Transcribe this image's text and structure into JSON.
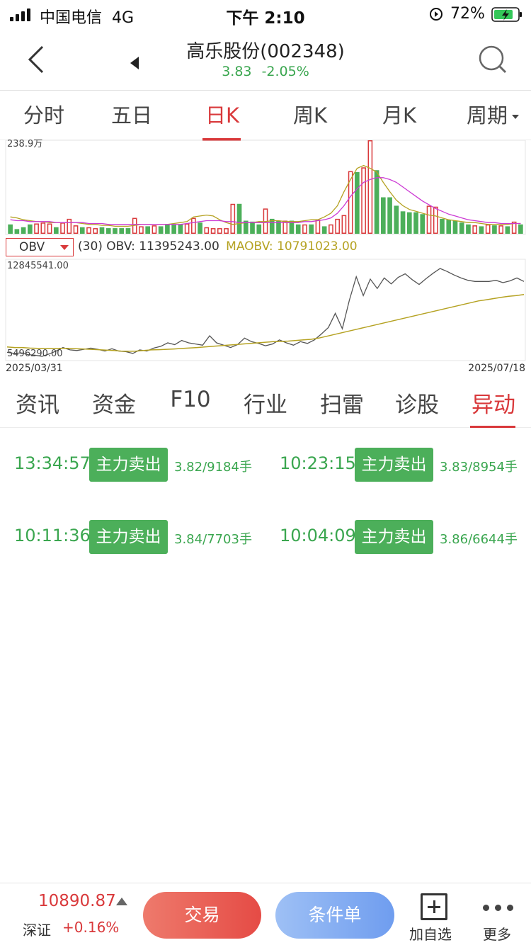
{
  "status_bar": {
    "carrier": "中国电信",
    "network": "4G",
    "time": "下午 2:10",
    "battery_percent": "72%"
  },
  "header": {
    "title": "高乐股份(002348)",
    "price": "3.83",
    "change_pct": "-2.05%"
  },
  "period_tabs": [
    {
      "label": "分时",
      "active": false
    },
    {
      "label": "五日",
      "active": false
    },
    {
      "label": "日K",
      "active": true
    },
    {
      "label": "周K",
      "active": false
    },
    {
      "label": "月K",
      "active": false
    },
    {
      "label": "周期",
      "active": false
    }
  ],
  "chart": {
    "volume_axis_label": "238.9万",
    "indicator_selected": "OBV",
    "obv_legend": "(30) OBV: 11395243.00",
    "maobv_legend": "MAOBV: 10791023.00",
    "obv_axis_max": "12845541.00",
    "obv_axis_min": "5496290.00",
    "date_start": "2025/03/31",
    "date_end": "2025/07/18"
  },
  "chart_data": {
    "type": "bar",
    "volume_max": 2389000,
    "volume_series": [
      {
        "up": false,
        "v": 0.1
      },
      {
        "up": false,
        "v": 0.05
      },
      {
        "up": false,
        "v": 0.07
      },
      {
        "up": false,
        "v": 0.1
      },
      {
        "up": true,
        "v": 0.11
      },
      {
        "up": true,
        "v": 0.12
      },
      {
        "up": true,
        "v": 0.11
      },
      {
        "up": false,
        "v": 0.07
      },
      {
        "up": true,
        "v": 0.12
      },
      {
        "up": true,
        "v": 0.16
      },
      {
        "up": true,
        "v": 0.09
      },
      {
        "up": false,
        "v": 0.07
      },
      {
        "up": true,
        "v": 0.07
      },
      {
        "up": true,
        "v": 0.06
      },
      {
        "up": false,
        "v": 0.07
      },
      {
        "up": false,
        "v": 0.06
      },
      {
        "up": false,
        "v": 0.06
      },
      {
        "up": false,
        "v": 0.06
      },
      {
        "up": false,
        "v": 0.06
      },
      {
        "up": true,
        "v": 0.17
      },
      {
        "up": true,
        "v": 0.08
      },
      {
        "up": false,
        "v": 0.08
      },
      {
        "up": true,
        "v": 0.09
      },
      {
        "up": false,
        "v": 0.08
      },
      {
        "up": false,
        "v": 0.1
      },
      {
        "up": false,
        "v": 0.1
      },
      {
        "up": false,
        "v": 0.1
      },
      {
        "up": true,
        "v": 0.11
      },
      {
        "up": true,
        "v": 0.17
      },
      {
        "up": false,
        "v": 0.12
      },
      {
        "up": true,
        "v": 0.07
      },
      {
        "up": true,
        "v": 0.06
      },
      {
        "up": true,
        "v": 0.06
      },
      {
        "up": true,
        "v": 0.06
      },
      {
        "up": true,
        "v": 0.32
      },
      {
        "up": false,
        "v": 0.32
      },
      {
        "up": false,
        "v": 0.14
      },
      {
        "up": false,
        "v": 0.13
      },
      {
        "up": false,
        "v": 0.1
      },
      {
        "up": true,
        "v": 0.27
      },
      {
        "up": false,
        "v": 0.16
      },
      {
        "up": false,
        "v": 0.14
      },
      {
        "up": true,
        "v": 0.14
      },
      {
        "up": false,
        "v": 0.14
      },
      {
        "up": false,
        "v": 0.1
      },
      {
        "up": true,
        "v": 0.1
      },
      {
        "up": false,
        "v": 0.1
      },
      {
        "up": true,
        "v": 0.15
      },
      {
        "up": false,
        "v": 0.08
      },
      {
        "up": true,
        "v": 0.1
      },
      {
        "up": true,
        "v": 0.16
      },
      {
        "up": true,
        "v": 0.2
      },
      {
        "up": true,
        "v": 0.67
      },
      {
        "up": false,
        "v": 0.66
      },
      {
        "up": true,
        "v": 0.71
      },
      {
        "up": true,
        "v": 1.0
      },
      {
        "up": false,
        "v": 0.68
      },
      {
        "up": false,
        "v": 0.39
      },
      {
        "up": false,
        "v": 0.39
      },
      {
        "up": false,
        "v": 0.3
      },
      {
        "up": false,
        "v": 0.24
      },
      {
        "up": false,
        "v": 0.23
      },
      {
        "up": false,
        "v": 0.23
      },
      {
        "up": false,
        "v": 0.21
      },
      {
        "up": true,
        "v": 0.3
      },
      {
        "up": true,
        "v": 0.29
      },
      {
        "up": false,
        "v": 0.16
      },
      {
        "up": false,
        "v": 0.15
      },
      {
        "up": false,
        "v": 0.14
      },
      {
        "up": false,
        "v": 0.12
      },
      {
        "up": false,
        "v": 0.1
      },
      {
        "up": true,
        "v": 0.09
      },
      {
        "up": false,
        "v": 0.08
      },
      {
        "up": true,
        "v": 0.1
      },
      {
        "up": false,
        "v": 0.09
      },
      {
        "up": true,
        "v": 0.09
      },
      {
        "up": false,
        "v": 0.08
      },
      {
        "up": true,
        "v": 0.13
      },
      {
        "up": false,
        "v": 0.1
      }
    ],
    "volume_ma_short": [
      0.18,
      0.17,
      0.15,
      0.14,
      0.13,
      0.13,
      0.12,
      0.12,
      0.12,
      0.12,
      0.12,
      0.11,
      0.1,
      0.1,
      0.09,
      0.09,
      0.08,
      0.08,
      0.08,
      0.09,
      0.1,
      0.1,
      0.1,
      0.1,
      0.1,
      0.11,
      0.12,
      0.13,
      0.18,
      0.19,
      0.2,
      0.19,
      0.15,
      0.12,
      0.1,
      0.11,
      0.12,
      0.12,
      0.13,
      0.13,
      0.14,
      0.14,
      0.13,
      0.13,
      0.13,
      0.14,
      0.15,
      0.15,
      0.18,
      0.22,
      0.3,
      0.45,
      0.58,
      0.7,
      0.73,
      0.7,
      0.66,
      0.55,
      0.45,
      0.36,
      0.3,
      0.26,
      0.24,
      0.22,
      0.2,
      0.19,
      0.17,
      0.15,
      0.14,
      0.13,
      0.12,
      0.12,
      0.11,
      0.1,
      0.1,
      0.1,
      0.1,
      0.11,
      0.11
    ],
    "volume_ma_long": [
      0.15,
      0.14,
      0.14,
      0.13,
      0.13,
      0.13,
      0.13,
      0.12,
      0.12,
      0.12,
      0.12,
      0.12,
      0.11,
      0.11,
      0.11,
      0.1,
      0.1,
      0.1,
      0.1,
      0.1,
      0.1,
      0.1,
      0.1,
      0.1,
      0.1,
      0.1,
      0.1,
      0.11,
      0.12,
      0.13,
      0.14,
      0.14,
      0.14,
      0.13,
      0.13,
      0.12,
      0.12,
      0.12,
      0.12,
      0.12,
      0.12,
      0.12,
      0.12,
      0.12,
      0.12,
      0.13,
      0.13,
      0.14,
      0.15,
      0.17,
      0.22,
      0.3,
      0.4,
      0.48,
      0.55,
      0.58,
      0.6,
      0.6,
      0.58,
      0.55,
      0.5,
      0.45,
      0.4,
      0.35,
      0.31,
      0.27,
      0.24,
      0.21,
      0.19,
      0.17,
      0.15,
      0.14,
      0.13,
      0.12,
      0.12,
      0.11,
      0.11,
      0.11,
      0.11
    ],
    "obv_series": [
      5900000,
      5800000,
      5850000,
      5700000,
      5650000,
      5550000,
      5750000,
      6000000,
      6300000,
      6100000,
      6050000,
      6150000,
      6250000,
      6150000,
      6000000,
      6200000,
      6000000,
      5950000,
      5800000,
      6100000,
      6000000,
      6250000,
      6400000,
      6700000,
      6550000,
      6900000,
      6700000,
      6600000,
      6500000,
      7300000,
      6700000,
      6500000,
      6300000,
      6550000,
      7100000,
      6800000,
      6650000,
      6450000,
      6600000,
      6950000,
      6700000,
      6500000,
      6800000,
      6650000,
      6950000,
      7450000,
      8000000,
      9200000,
      7900000,
      10300000,
      12300000,
      10700000,
      12100000,
      11300000,
      12200000,
      11700000,
      12250000,
      12550000,
      12050000,
      11650000,
      12150000,
      12600000,
      13000000,
      12750000,
      12450000,
      12200000,
      12000000,
      11900000,
      11900000,
      11900000,
      12000000,
      11800000,
      11950000,
      12200000,
      11900000
    ],
    "maobv_series": [
      6350000,
      6300000,
      6300000,
      6250000,
      6230000,
      6230000,
      6230000,
      6230000,
      6230000,
      6200000,
      6180000,
      6150000,
      6120000,
      6080000,
      6050000,
      6000000,
      5980000,
      6000000,
      6050000,
      6100000,
      6120000,
      6150000,
      6180000,
      6220000,
      6260000,
      6300000,
      6350000,
      6400000,
      6450000,
      6500000,
      6550000,
      6600000,
      6650000,
      6700000,
      6750000,
      6800000,
      6820000,
      6850000,
      6900000,
      6950000,
      7000000,
      7100000,
      7250000,
      7400000,
      7550000,
      7700000,
      7850000,
      8000000,
      8150000,
      8300000,
      8450000,
      8600000,
      8750000,
      8900000,
      9050000,
      9200000,
      9350000,
      9500000,
      9650000,
      9800000,
      9950000,
      10100000,
      10250000,
      10350000,
      10450000,
      10550000,
      10650000,
      10700000,
      10791023
    ],
    "obv_ylim": [
      5496290,
      12845541
    ]
  },
  "info_tabs": [
    {
      "label": "资讯",
      "active": false
    },
    {
      "label": "资金",
      "active": false
    },
    {
      "label": "F10",
      "active": false
    },
    {
      "label": "行业",
      "active": false
    },
    {
      "label": "扫雷",
      "active": false
    },
    {
      "label": "诊股",
      "active": false
    },
    {
      "label": "异动",
      "active": true
    }
  ],
  "alerts": [
    {
      "time": "13:34:57",
      "tag": "主力卖出",
      "detail": "3.82/9184手"
    },
    {
      "time": "10:23:15",
      "tag": "主力卖出",
      "detail": "3.83/8954手"
    },
    {
      "time": "10:11:36",
      "tag": "主力卖出",
      "detail": "3.84/7703手"
    },
    {
      "time": "10:04:09",
      "tag": "主力卖出",
      "detail": "3.86/6644手"
    }
  ],
  "bottom_bar": {
    "index_value": "10890.87",
    "index_name": "深证",
    "index_change": "+0.16%",
    "trade_label": "交易",
    "condition_label": "条件单",
    "add_watch_label": "加自选",
    "more_label": "更多"
  },
  "colors": {
    "up_red": "#d9393b",
    "down_green": "#4caf5a",
    "ma_short_yellow": "#b5a222",
    "ma_long_magenta": "#cc3ad4",
    "obv_line": "#555555"
  },
  "icons": [
    "signal-icon",
    "rotation-lock-icon",
    "battery-charging-icon",
    "back-icon",
    "prev-stock-icon",
    "search-icon",
    "dropdown-icon",
    "add-watchlist-icon",
    "more-icon"
  ]
}
